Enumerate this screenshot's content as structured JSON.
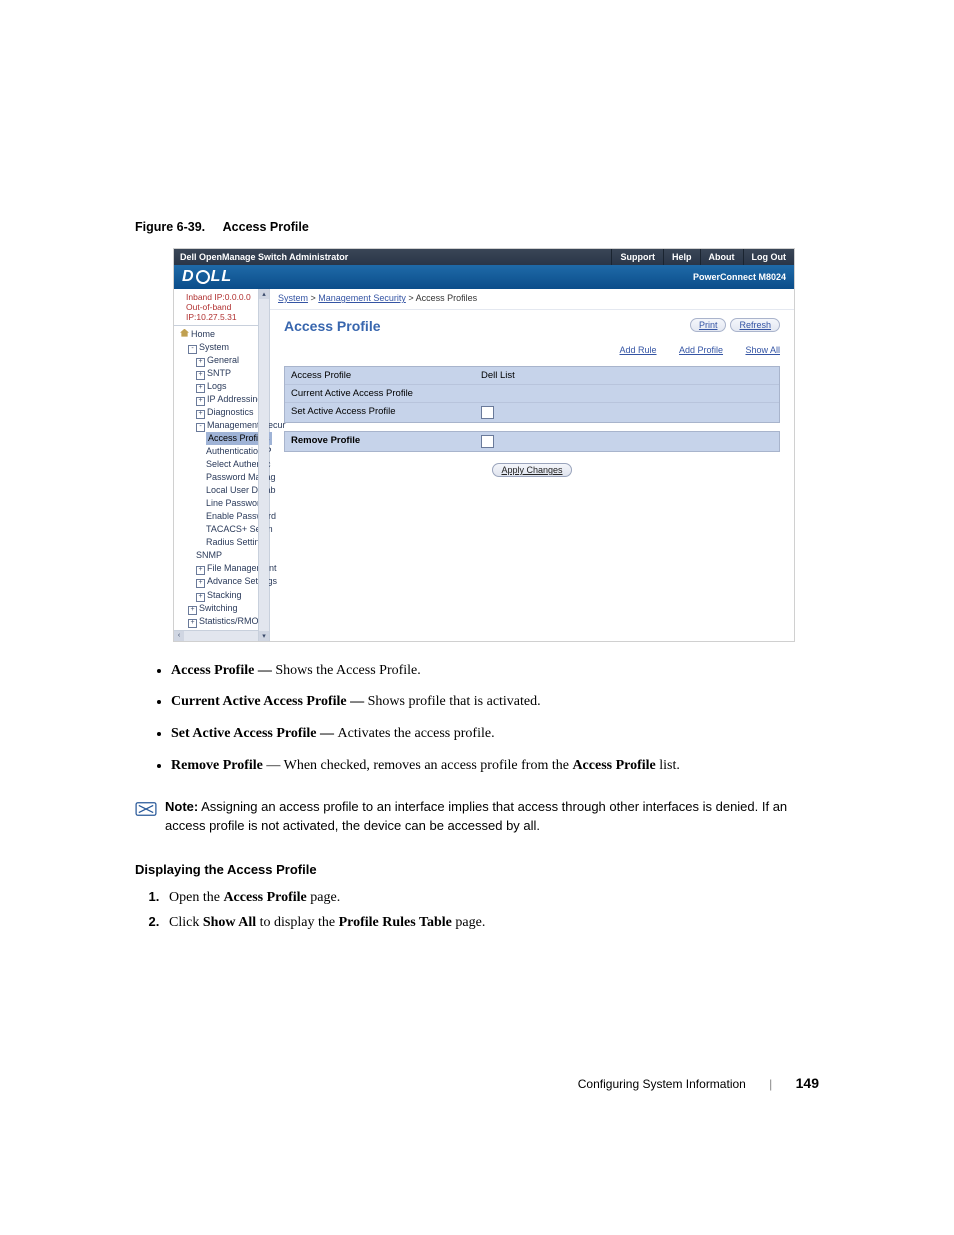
{
  "figure": {
    "label": "Figure 6-39.",
    "title": "Access Profile"
  },
  "screenshot": {
    "window_title": "Dell OpenManage Switch Administrator",
    "topbar": [
      "Support",
      "Help",
      "About",
      "Log Out"
    ],
    "product": "PowerConnect M8024",
    "ip": {
      "inband": "Inband IP:0.0.0.0",
      "oob": "Out-of-band IP:10.27.5.31"
    },
    "tree": {
      "home": "Home",
      "system": "System",
      "general": "General",
      "sntp": "SNTP",
      "logs": "Logs",
      "ip_addr": "IP Addressing",
      "diag": "Diagnostics",
      "mgmt_sec": "Management Secur",
      "access_profiles": "Access Profiles",
      "auth_p": "Authentication P",
      "sel_auth": "Select Authentic",
      "pw_mgmt": "Password Manag",
      "local_user": "Local User Datab",
      "line_pw": "Line Password",
      "enable_pw": "Enable Password",
      "tacacs": "TACACS+ Settin",
      "radius": "Radius Settings",
      "snmp": "SNMP",
      "file_mgmt": "File Management",
      "adv": "Advance Settings",
      "stack": "Stacking",
      "switching": "Switching",
      "stats": "Statistics/RMON"
    },
    "breadcrumb": {
      "a": "System",
      "b": "Management Security",
      "c": "Access Profiles"
    },
    "main_title": "Access Profile",
    "pill": {
      "print": "Print",
      "refresh": "Refresh"
    },
    "links": {
      "add_rule": "Add Rule",
      "add_profile": "Add Profile",
      "show_all": "Show All"
    },
    "panel": {
      "r1a": "Access Profile",
      "r1b": "Dell List",
      "r2a": "Current Active Access Profile",
      "r3a": "Set Active Access Profile"
    },
    "remove_label": "Remove Profile",
    "apply": "Apply Changes"
  },
  "bullets": {
    "b1": {
      "term": "Access Profile — ",
      "desc": "Shows the Access Profile."
    },
    "b2": {
      "term": "Current Active Access Profile — ",
      "desc": "Shows profile that is activated."
    },
    "b3": {
      "term": "Set Active Access Profile — ",
      "desc": "Activates the access profile."
    },
    "b4": {
      "term": "Remove Profile",
      "mid": " — When checked, removes an access profile from the ",
      "term2": "Access Profile",
      "tail": " list."
    }
  },
  "note": {
    "label": "Note:",
    "text1": " Assigning an access profile to an interface implies that access through other interfaces is denied. If an",
    "text2": "access profile is not activated, the device can be accessed by all."
  },
  "section_h": "Displaying the Access Profile",
  "steps": {
    "s1a": "Open the ",
    "s1b": "Access Profile",
    "s1c": " page.",
    "s2a": "Click ",
    "s2b": "Show All",
    "s2c": " to display the ",
    "s2d": "Profile Rules Table",
    "s2e": " page."
  },
  "footer": {
    "section": "Configuring System Information",
    "page": "149"
  }
}
